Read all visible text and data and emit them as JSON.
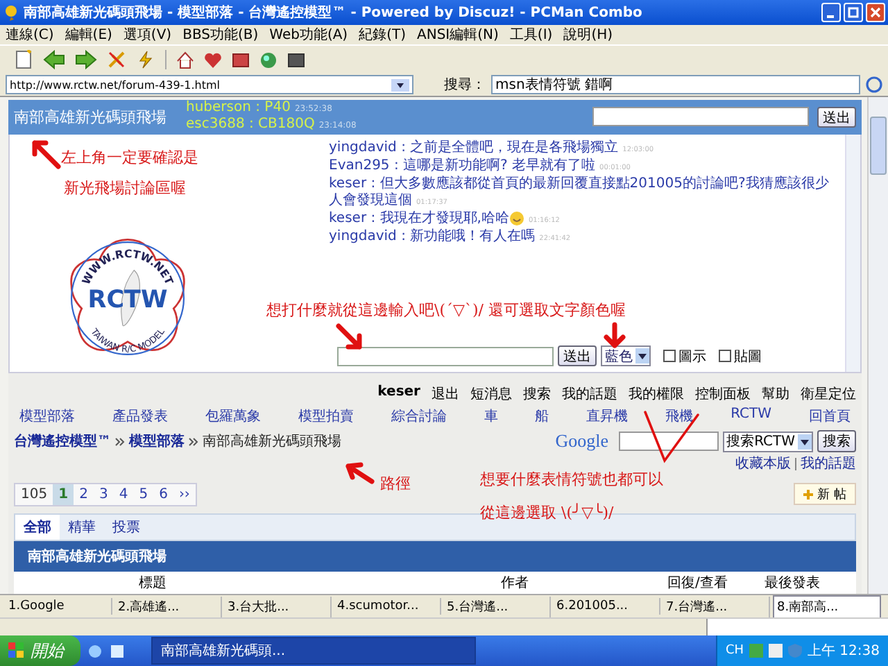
{
  "window": {
    "title": "南部高雄新光碼頭飛場 - 模型部落 - 台灣遙控模型™ - Powered by Discuz! - PCMan Combo"
  },
  "menu": [
    "連線(C)",
    "編輯(E)",
    "選項(V)",
    "BBS功能(B)",
    "Web功能(A)",
    "紀錄(T)",
    "ANSI編輯(N)",
    "工具(I)",
    "說明(H)"
  ],
  "address": {
    "url": "http://www.rctw.net/forum-439-1.html",
    "search_label": "搜尋：",
    "search_value": "msn表情符號 錯啊"
  },
  "shoutbox": {
    "title": "南部高雄新光碼頭飛場",
    "online": [
      {
        "name": "huberson :",
        "role": "P40",
        "time": "23:52:38"
      },
      {
        "name": "esc3688 :",
        "role": "CB180Q",
        "time": "23:14:08"
      }
    ],
    "send_top": "送出",
    "send_bottom": "送出",
    "logo": {
      "title": "RCTW",
      "top": "WWW.RCTW.NET",
      "bottom": "TAIWAN R/C MODEL"
    },
    "messages": [
      {
        "user": "yingdavid :",
        "text": "之前是全體吧，現在是各飛場獨立",
        "time": "12:03:00",
        "emoticon": false
      },
      {
        "user": "Evan295 :",
        "text": "這哪是新功能啊? 老早就有了啦",
        "time": "00:01:00",
        "emoticon": false
      },
      {
        "user": "keser :",
        "text": "但大多數應該都從首頁的最新回覆直接點201005的討論吧?我猜應該很少人會發現這個",
        "time": "01:17:37",
        "emoticon": false
      },
      {
        "user": "keser :",
        "text": "我現在才發現耶,哈哈",
        "time": "01:16:12",
        "emoticon": true
      },
      {
        "user": "yingdavid :",
        "text": "新功能哦！有人在嗎",
        "time": "22:41:42",
        "emoticon": false
      }
    ],
    "color_select": "藍色",
    "options": [
      {
        "label": "圖示",
        "checked": false
      },
      {
        "label": "貼圖",
        "checked": false
      }
    ]
  },
  "user_links": [
    "keser",
    "退出",
    "短消息",
    "搜索",
    "我的話題",
    "我的權限",
    "控制面板",
    "幫助",
    "衛星定位"
  ],
  "nav": [
    "模型部落",
    "產品發表",
    "包羅萬象",
    "模型拍賣",
    "綜合討論",
    "車",
    "船",
    "直昇機",
    "飛機",
    "RCTW",
    "回首頁"
  ],
  "breadcrumb": [
    "台灣遙控模型™",
    "模型部落",
    "南部高雄新光碼頭飛場"
  ],
  "google": {
    "logo": "Google",
    "select": "搜索RCTW",
    "button": "搜索"
  },
  "quick_links": [
    "收藏本版",
    "我的話題"
  ],
  "pagination": {
    "total": "105",
    "pages": [
      {
        "label": "1",
        "selected": true
      },
      {
        "label": "2",
        "selected": false
      },
      {
        "label": "3",
        "selected": false
      },
      {
        "label": "4",
        "selected": false
      },
      {
        "label": "5",
        "selected": false
      },
      {
        "label": "6",
        "selected": false
      }
    ],
    "next": "››"
  },
  "new_post": "新 帖",
  "filter_tabs": [
    {
      "label": "全部",
      "selected": true
    },
    {
      "label": "精華",
      "selected": false
    },
    {
      "label": "投票",
      "selected": false
    }
  ],
  "forum": {
    "title": "南部高雄新光碼頭飛場",
    "columns": [
      "標題",
      "作者",
      "回復/查看",
      "最後發表"
    ]
  },
  "browser_tabs": [
    {
      "label": "1.Google",
      "selected": false
    },
    {
      "label": "2.高雄遙...",
      "selected": false
    },
    {
      "label": "3.台大批...",
      "selected": false
    },
    {
      "label": "4.scumotor...",
      "selected": false
    },
    {
      "label": "5.台灣遙...",
      "selected": false
    },
    {
      "label": "6.201005...",
      "selected": false
    },
    {
      "label": "7.台灣遙...",
      "selected": false
    },
    {
      "label": "8.南部高...",
      "selected": true
    }
  ],
  "taskbar": {
    "start": "開始",
    "task": "南部高雄新光碼頭...",
    "lang": "CH",
    "clock": "上午 12:38"
  },
  "annotations": [
    "左上角一定要確認是",
    "新光飛場討論區喔",
    "想打什麼就從這邊輸入吧\\(ˊ▽ˋ)/ 還可選取文字顏色喔",
    "路徑",
    "想要什麼表情符號也都可以",
    "從這邊選取 \\(╯▽╰)/"
  ]
}
